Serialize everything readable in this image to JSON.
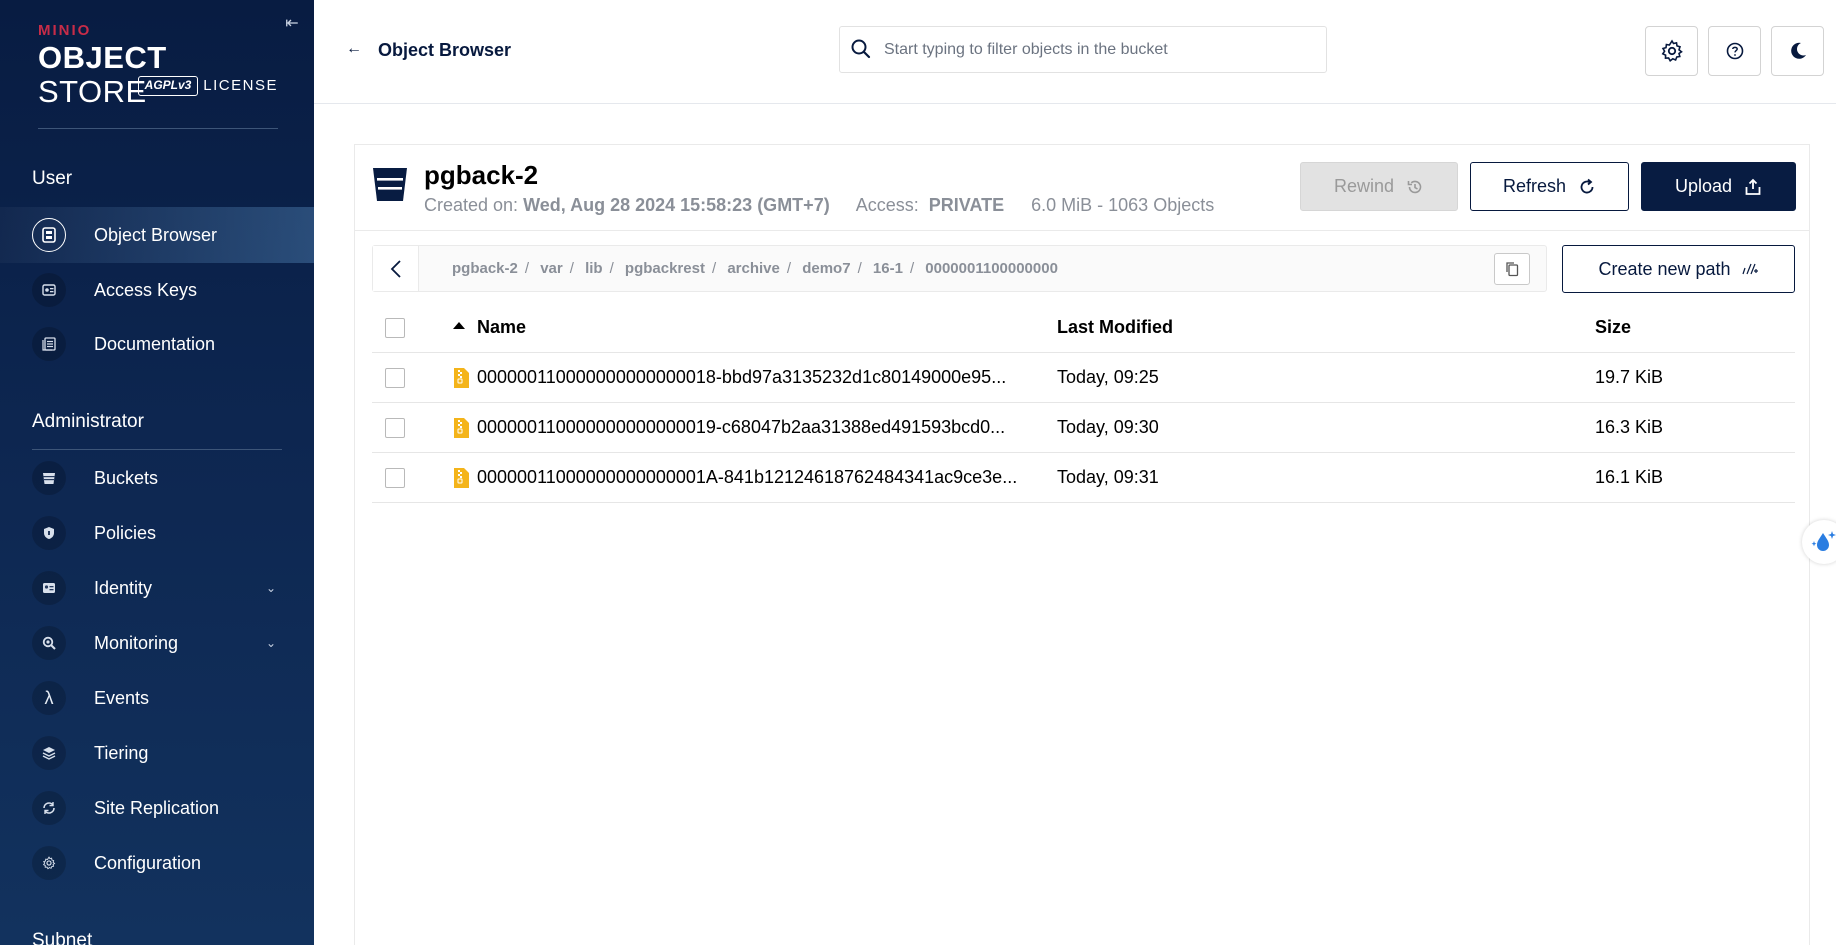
{
  "sidebar": {
    "logo": {
      "brand": "MINIO",
      "product_bold": "OBJECT",
      "product_thin": "STORE",
      "license_badge": "AGPLv3",
      "license_text": "LICENSE"
    },
    "user_section": {
      "title": "User",
      "items": [
        {
          "label": "Object Browser",
          "icon": "object-browser-icon",
          "active": true
        },
        {
          "label": "Access Keys",
          "icon": "access-keys-icon"
        },
        {
          "label": "Documentation",
          "icon": "documentation-icon"
        }
      ]
    },
    "admin_section": {
      "title": "Administrator",
      "items": [
        {
          "label": "Buckets",
          "icon": "bucket-icon"
        },
        {
          "label": "Policies",
          "icon": "policy-icon"
        },
        {
          "label": "Identity",
          "icon": "identity-icon",
          "expandable": true
        },
        {
          "label": "Monitoring",
          "icon": "monitoring-icon",
          "expandable": true
        },
        {
          "label": "Events",
          "icon": "lambda-icon"
        },
        {
          "label": "Tiering",
          "icon": "tiering-icon"
        },
        {
          "label": "Site Replication",
          "icon": "replication-icon"
        },
        {
          "label": "Configuration",
          "icon": "gear-icon"
        }
      ]
    },
    "subnet_section": {
      "title": "Subnet"
    }
  },
  "header": {
    "title": "Object Browser",
    "search": {
      "placeholder": "Start typing to filter objects in the bucket",
      "value": ""
    }
  },
  "bucket": {
    "name": "pgback-2",
    "created_label": "Created on:",
    "created_value": "Wed, Aug 28 2024 15:58:23 (GMT+7)",
    "access_label": "Access:",
    "access_value": "PRIVATE",
    "usage": "6.0 MiB - 1063 Objects",
    "buttons": {
      "rewind": "Rewind",
      "refresh": "Refresh",
      "upload": "Upload"
    }
  },
  "breadcrumb": {
    "segments": [
      "pgback-2",
      "var",
      "lib",
      "pgbackrest",
      "archive",
      "demo7",
      "16-1",
      "0000001100000000"
    ],
    "create_path_label": "Create new path"
  },
  "table": {
    "headers": {
      "name": "Name",
      "modified": "Last Modified",
      "size": "Size"
    },
    "rows": [
      {
        "name": "000000110000000000000018-bbd97a3135232d1c80149000e95...",
        "modified": "Today, 09:25",
        "size": "19.7 KiB"
      },
      {
        "name": "000000110000000000000019-c68047b2aa31388ed491593bcd0...",
        "modified": "Today, 09:30",
        "size": "16.3 KiB"
      },
      {
        "name": "00000011000000000000001A-841b12124618762484341ac9ce3e...",
        "modified": "Today, 09:31",
        "size": "16.1 KiB"
      }
    ]
  },
  "colors": {
    "sidebar_bg": "#081c42",
    "primary": "#07193e",
    "file_icon": "#f4b41a",
    "brand_red": "#c72c48"
  }
}
